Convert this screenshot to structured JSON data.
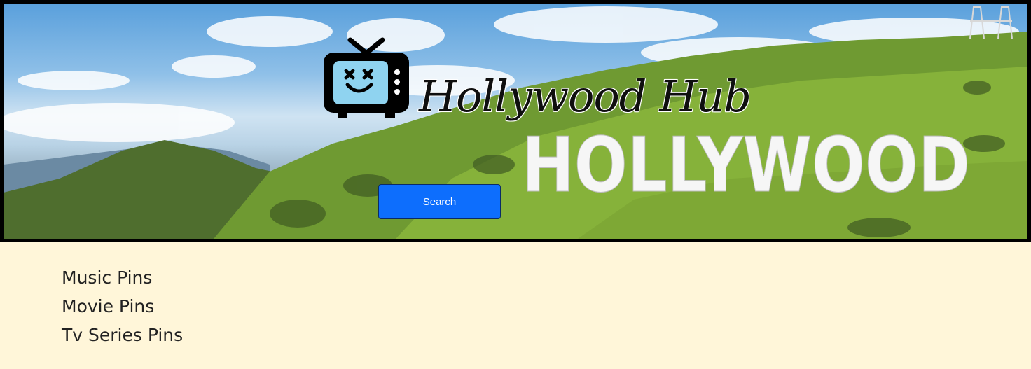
{
  "hero": {
    "brand_title": "Hollywood Hub",
    "sign_text": "HOLLYWOOD",
    "logo_icon": "tv-face-icon",
    "search_label": "Search"
  },
  "pins": [
    {
      "label": "Music Pins"
    },
    {
      "label": "Movie Pins"
    },
    {
      "label": "Tv Series Pins"
    }
  ],
  "colors": {
    "page_background": "#fff6d9",
    "button": "#0d6efd",
    "text": "#222222"
  }
}
